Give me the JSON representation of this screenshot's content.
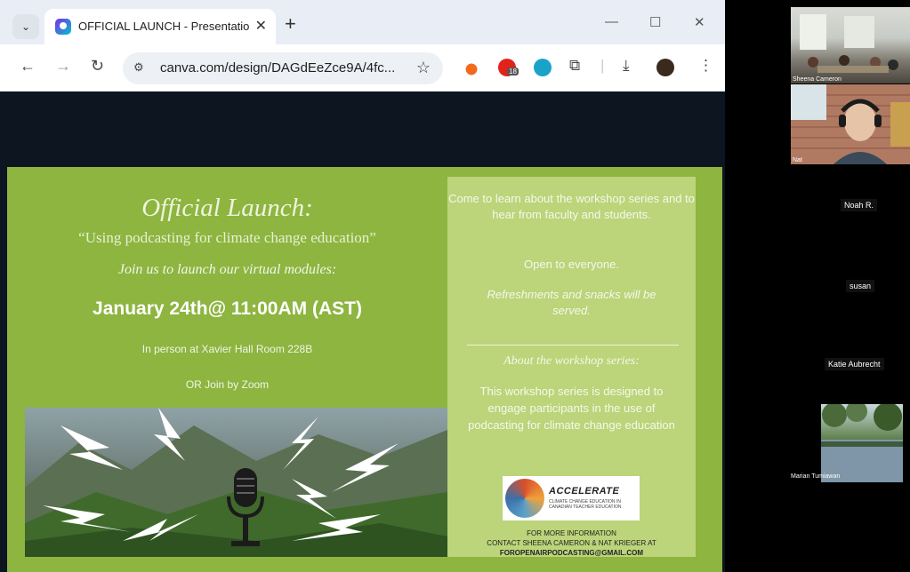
{
  "browser": {
    "tab_title": "OFFICIAL LAUNCH - Presentatio",
    "new_tab": "+",
    "close_tab": "✕",
    "window_buttons": {
      "minimize": "—",
      "maximize": "☐",
      "close": "✕"
    },
    "url": "canva.com/design/DAGdEeZce9A/4fc...",
    "extension_badge": "18"
  },
  "slide": {
    "title": "Official Launch:",
    "subtitle": "“Using podcasting for climate change education”",
    "join_line": "Join us to launch our virtual modules:",
    "date_line": "January 24th@ 11:00AM (AST)",
    "location": "In person at Xavier Hall Room 228B",
    "zoom_line": "OR Join by Zoom",
    "info": {
      "intro": "Come to learn about the workshop series and to hear from faculty and students.",
      "open": "Open to everyone.",
      "refreshments": "Refreshments and snacks will be served.",
      "about_heading": "About the workshop series:",
      "about_text": "This workshop series is designed to engage participants in the use of podcasting for climate change education",
      "logo_name": "ACCELERATE",
      "logo_tagline": "CLIMATE CHANGE EDUCATION IN CANADIAN TEACHER EDUCATION",
      "more_info": "FOR MORE INFORMATION",
      "contact_line": "CONTACT SHEENA CAMERON & NAT KRIEGER AT",
      "email": "FOROPENAIRPODCASTING@GMAIL.COM"
    }
  },
  "participants": {
    "tile1_name": "Sheena Cameron",
    "tile2_name": "Nat",
    "noah": "Noah R.",
    "susan": "susan",
    "katie": "Katie Aubrecht",
    "marian": "Marian Tumiawan"
  }
}
